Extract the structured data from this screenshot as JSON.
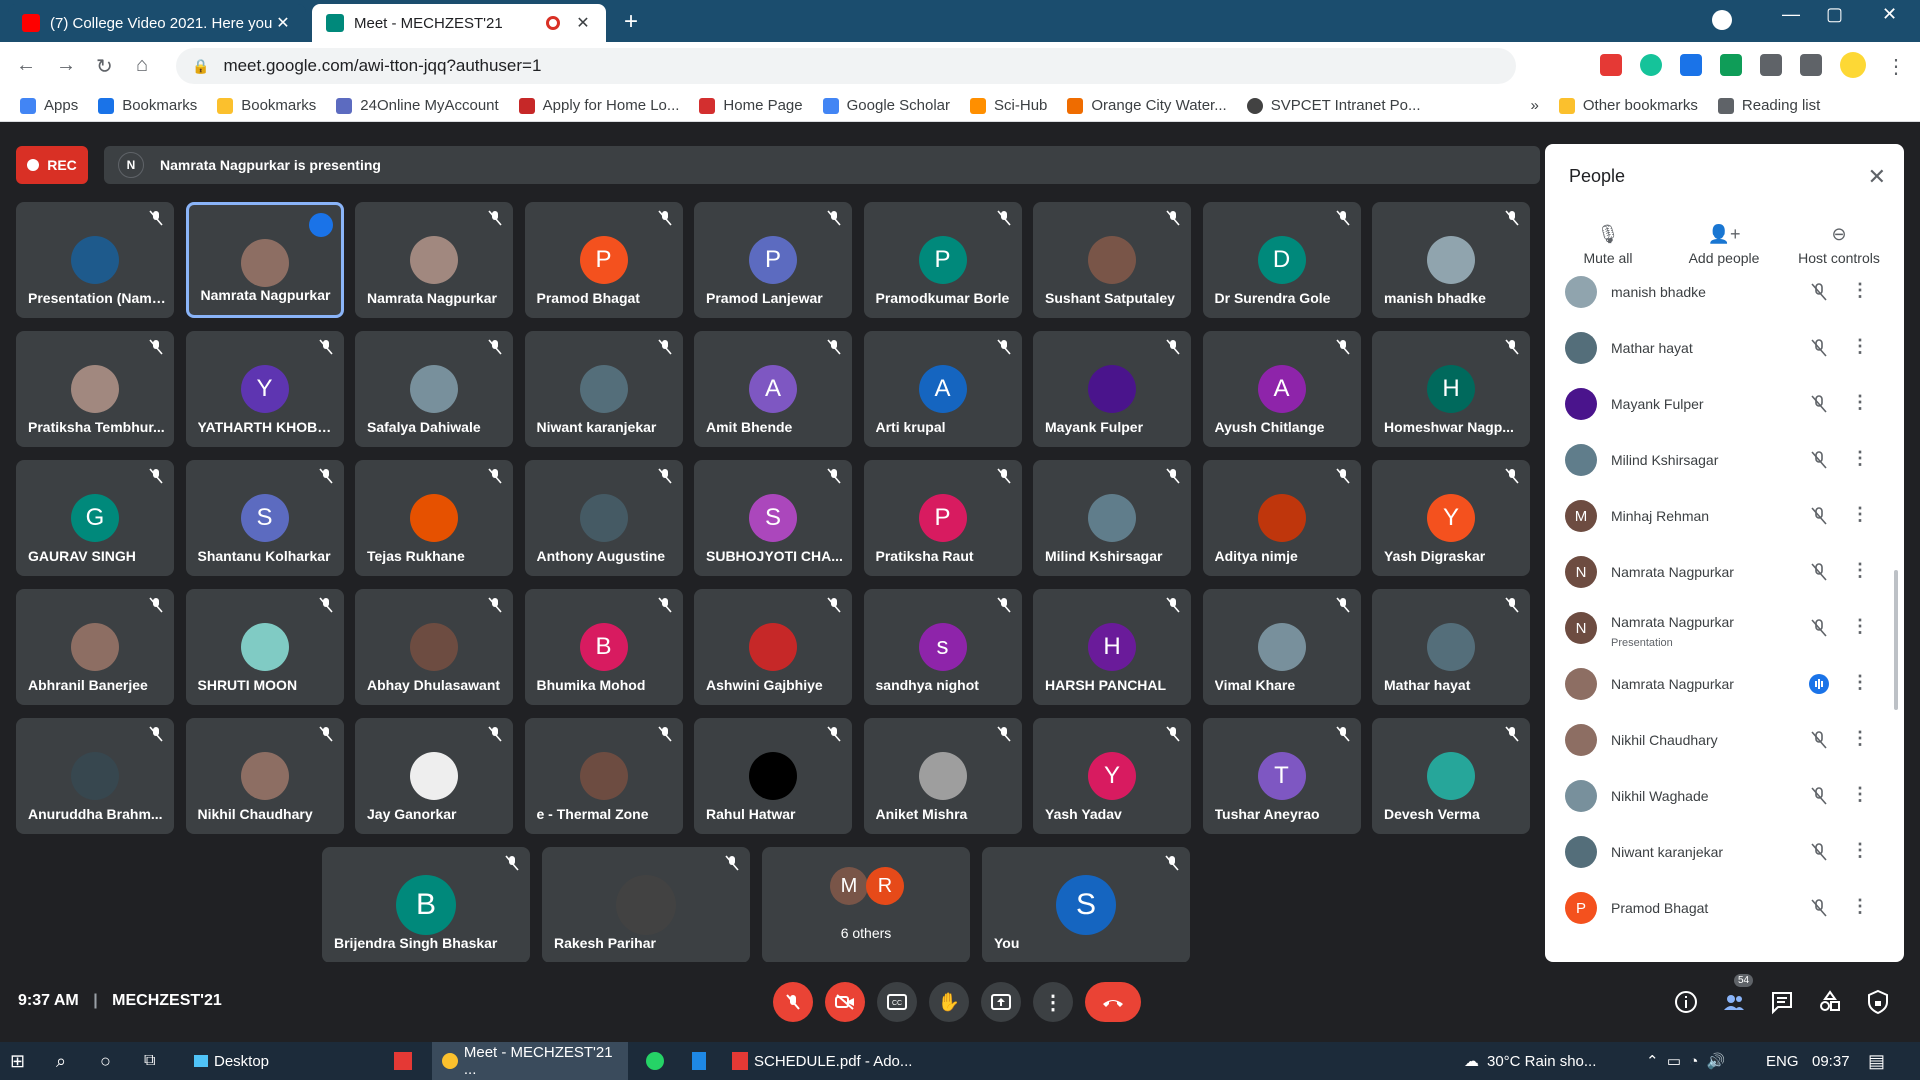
{
  "browser": {
    "tabs": [
      {
        "title": "(7) College Video 2021. Here you",
        "favicon_color": "#ff0000"
      },
      {
        "title": "Meet - MECHZEST'21",
        "favicon_color": "#00897b"
      }
    ],
    "url": "meet.google.com/awi-tton-jqq?authuser=1",
    "bookmarks": [
      "Apps",
      "Bookmarks",
      "Bookmarks",
      "24Online MyAccount",
      "Apply for Home Lo...",
      "Home Page",
      "Google Scholar",
      "Sci-Hub",
      "Orange City Water...",
      "SVPCET Intranet Po..."
    ],
    "other_bookmarks": "Other bookmarks",
    "reading_list": "Reading list"
  },
  "meet": {
    "rec_label": "REC",
    "presenter_initial": "N",
    "presenting_text": "Namrata Nagpurkar is presenting",
    "tiles": [
      {
        "name": "Presentation (Namrata Na...",
        "initial": "",
        "color": "#1e5a8c"
      },
      {
        "name": "Namrata Nagpurkar",
        "initial": "",
        "color": "#8d6e63"
      },
      {
        "name": "Namrata Nagpurkar",
        "initial": "",
        "color": "#a1887f"
      },
      {
        "name": "Pramod Bhagat",
        "initial": "P",
        "color": "#f4511e"
      },
      {
        "name": "Pramod Lanjewar",
        "initial": "P",
        "color": "#5c6bc0"
      },
      {
        "name": "Pramodkumar Borle",
        "initial": "P",
        "color": "#00897b"
      },
      {
        "name": "Sushant Satputaley",
        "initial": "",
        "color": "#795548"
      },
      {
        "name": "Dr Surendra Gole",
        "initial": "D",
        "color": "#00897b"
      },
      {
        "name": "manish bhadke",
        "initial": "",
        "color": "#90a4ae"
      },
      {
        "name": "Pratiksha Tembhur...",
        "initial": "",
        "color": "#a1887f"
      },
      {
        "name": "YATHARTH KHOBR...",
        "initial": "Y",
        "color": "#5e35b1"
      },
      {
        "name": "Safalya Dahiwale",
        "initial": "",
        "color": "#78909c"
      },
      {
        "name": "Niwant karanjekar",
        "initial": "",
        "color": "#546e7a"
      },
      {
        "name": "Amit Bhende",
        "initial": "A",
        "color": "#7e57c2"
      },
      {
        "name": "Arti krupal",
        "initial": "A",
        "color": "#1565c0"
      },
      {
        "name": "Mayank Fulper",
        "initial": "",
        "color": "#4a148c"
      },
      {
        "name": "Ayush Chitlange",
        "initial": "A",
        "color": "#8e24aa"
      },
      {
        "name": "Homeshwar Nagp...",
        "initial": "H",
        "color": "#00695c"
      },
      {
        "name": "GAURAV SINGH",
        "initial": "G",
        "color": "#00897b"
      },
      {
        "name": "Shantanu Kolharkar",
        "initial": "S",
        "color": "#5c6bc0"
      },
      {
        "name": "Tejas Rukhane",
        "initial": "",
        "color": "#e65100"
      },
      {
        "name": "Anthony Augustine",
        "initial": "",
        "color": "#455a64"
      },
      {
        "name": "SUBHOJYOTI CHA...",
        "initial": "S",
        "color": "#ab47bc"
      },
      {
        "name": "Pratiksha Raut",
        "initial": "P",
        "color": "#d81b60"
      },
      {
        "name": "Milind Kshirsagar",
        "initial": "",
        "color": "#607d8b"
      },
      {
        "name": "Aditya nimje",
        "initial": "",
        "color": "#bf360c"
      },
      {
        "name": "Yash Digraskar",
        "initial": "Y",
        "color": "#f4511e"
      },
      {
        "name": "Abhranil Banerjee",
        "initial": "",
        "color": "#8d6e63"
      },
      {
        "name": "SHRUTI MOON",
        "initial": "",
        "color": "#80cbc4"
      },
      {
        "name": "Abhay Dhulasawant",
        "initial": "",
        "color": "#6d4c41"
      },
      {
        "name": "Bhumika Mohod",
        "initial": "B",
        "color": "#d81b60"
      },
      {
        "name": "Ashwini Gajbhiye",
        "initial": "",
        "color": "#c62828"
      },
      {
        "name": "sandhya nighot",
        "initial": "s",
        "color": "#8e24aa"
      },
      {
        "name": "HARSH PANCHAL",
        "initial": "H",
        "color": "#6a1b9a"
      },
      {
        "name": "Vimal Khare",
        "initial": "",
        "color": "#78909c"
      },
      {
        "name": "Mathar hayat",
        "initial": "",
        "color": "#546e7a"
      },
      {
        "name": "Anuruddha Brahm...",
        "initial": "",
        "color": "#37474f"
      },
      {
        "name": "Nikhil Chaudhary",
        "initial": "",
        "color": "#8d6e63"
      },
      {
        "name": "Jay Ganorkar",
        "initial": "",
        "color": "#eeeeee"
      },
      {
        "name": "e - Thermal Zone",
        "initial": "",
        "color": "#6d4c41"
      },
      {
        "name": "Rahul Hatwar",
        "initial": "",
        "color": "#000000"
      },
      {
        "name": "Aniket Mishra",
        "initial": "",
        "color": "#9e9e9e"
      },
      {
        "name": "Yash Yadav",
        "initial": "Y",
        "color": "#d81b60"
      },
      {
        "name": "Tushar Aneyrao",
        "initial": "T",
        "color": "#7e57c2"
      },
      {
        "name": "Devesh Verma",
        "initial": "",
        "color": "#26a69a"
      }
    ],
    "bottom_tiles": [
      {
        "name": "Brijendra Singh Bhaskar",
        "initial": "B",
        "color": "#00897b"
      },
      {
        "name": "Rakesh Parihar",
        "initial": "",
        "color": "#424242"
      },
      {
        "name": "6 others",
        "initial": "",
        "color": ""
      },
      {
        "name": "You",
        "initial": "S",
        "color": "#1565c0"
      }
    ],
    "others_initials": [
      "M",
      "R"
    ],
    "time": "9:37 AM",
    "meeting_name": "MECHZEST'21",
    "people_count": "54"
  },
  "people_panel": {
    "title": "People",
    "actions": [
      "Mute all",
      "Add people",
      "Host controls"
    ],
    "rows": [
      {
        "name": "manish bhadke",
        "sub": "",
        "initial": "",
        "color": "#90a4ae"
      },
      {
        "name": "Mathar hayat",
        "sub": "",
        "initial": "",
        "color": "#546e7a"
      },
      {
        "name": "Mayank Fulper",
        "sub": "",
        "initial": "",
        "color": "#4a148c"
      },
      {
        "name": "Milind Kshirsagar",
        "sub": "",
        "initial": "",
        "color": "#607d8b"
      },
      {
        "name": "Minhaj Rehman",
        "sub": "",
        "initial": "M",
        "color": "#6d4c41"
      },
      {
        "name": "Namrata Nagpurkar",
        "sub": "",
        "initial": "N",
        "color": "#6d4c41"
      },
      {
        "name": "Namrata Nagpurkar",
        "sub": "Presentation",
        "initial": "N",
        "color": "#6d4c41"
      },
      {
        "name": "Namrata Nagpurkar",
        "sub": "",
        "initial": "",
        "color": "#8d6e63"
      },
      {
        "name": "Nikhil Chaudhary",
        "sub": "",
        "initial": "",
        "color": "#8d6e63"
      },
      {
        "name": "Nikhil Waghade",
        "sub": "",
        "initial": "",
        "color": "#78909c"
      },
      {
        "name": "Niwant karanjekar",
        "sub": "",
        "initial": "",
        "color": "#546e7a"
      },
      {
        "name": "Pramod Bhagat",
        "sub": "",
        "initial": "P",
        "color": "#f4511e"
      }
    ]
  },
  "taskbar": {
    "items": [
      "Desktop",
      "Meet - MECHZEST'21 ...",
      "SCHEDULE.pdf - Ado..."
    ],
    "weather": "30°C  Rain sho...",
    "lang": "ENG",
    "clock": "09:37"
  }
}
